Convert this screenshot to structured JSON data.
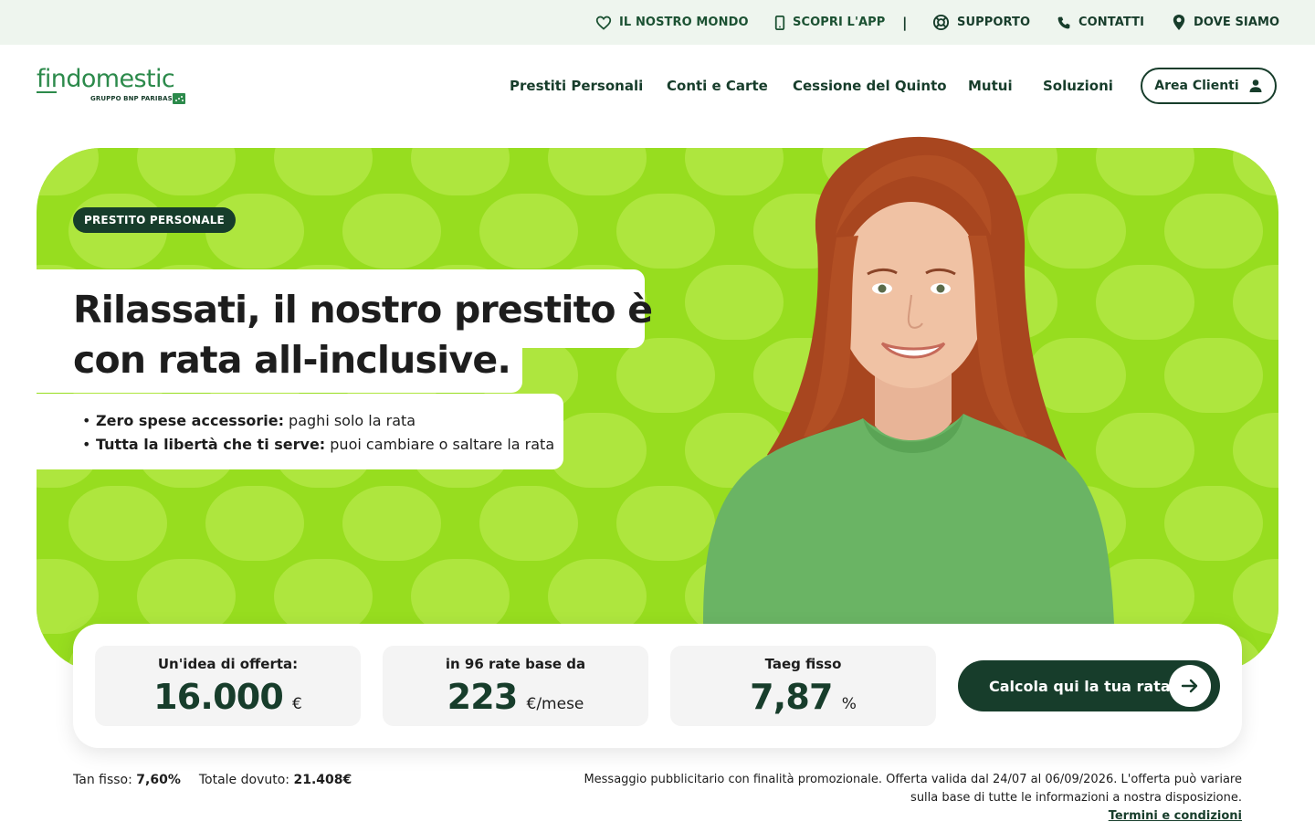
{
  "topbar": {
    "links": [
      {
        "label": "IL NOSTRO MONDO",
        "icon": "heart-icon"
      },
      {
        "label": "SCOPRI L'APP",
        "icon": "smartphone-icon"
      },
      {
        "label": "SUPPORTO",
        "icon": "lifebuoy-icon"
      },
      {
        "label": "CONTATTI",
        "icon": "phone-icon"
      },
      {
        "label": "DOVE SIAMO",
        "icon": "location-pin-icon"
      }
    ],
    "separator": "|"
  },
  "brand": {
    "name": "findomestic",
    "tagline": "GRUPPO BNP PARIBAS",
    "color": "#2c8a4b"
  },
  "nav": {
    "items": [
      "Prestiti Personali",
      "Conti e Carte",
      "Cessione del Quinto",
      "Mutui",
      "Soluzioni"
    ],
    "area_clienti": "Area Clienti"
  },
  "hero": {
    "badge": "PRESTITO PERSONALE",
    "title_line1_regular": "Rilassati, il nostro ",
    "title_line1_bold": "prestito è",
    "title_line2_bold": "con rata all-inclusive.",
    "bullets": [
      {
        "bold": "Zero spese accessorie:",
        "text": " paghi solo la rata"
      },
      {
        "bold": "Tutta la libertà che ti serve:",
        "text": " puoi cambiare o saltare la rata"
      }
    ],
    "background_color": "#97dd1f",
    "pattern_color": "#aee63e"
  },
  "offer": {
    "boxes": [
      {
        "label": "Un'idea di offerta:",
        "value": "16.000",
        "unit": "€"
      },
      {
        "label": "in 96 rate base da",
        "value": "223",
        "unit": "€/mese"
      },
      {
        "label": "Taeg fisso",
        "value": "7,87",
        "unit": "%"
      }
    ],
    "cta": "Calcola qui la tua rata"
  },
  "fineprint": {
    "tan_label": "Tan fisso:",
    "tan_value": "7,60%",
    "totale_label": "Totale dovuto:",
    "totale_value": "21.408€",
    "message_line1": "Messaggio pubblicitario con finalità promozionale. Offerta valida dal 24/07 al 06/09/2026. L'offerta può variare",
    "message_line2": "sulla base di tutte le informazioni a nostra disposizione.",
    "terms": "Termini e condizioni"
  },
  "colors": {
    "dark_green": "#173d2b",
    "topbar_bg": "#eef5ee"
  }
}
